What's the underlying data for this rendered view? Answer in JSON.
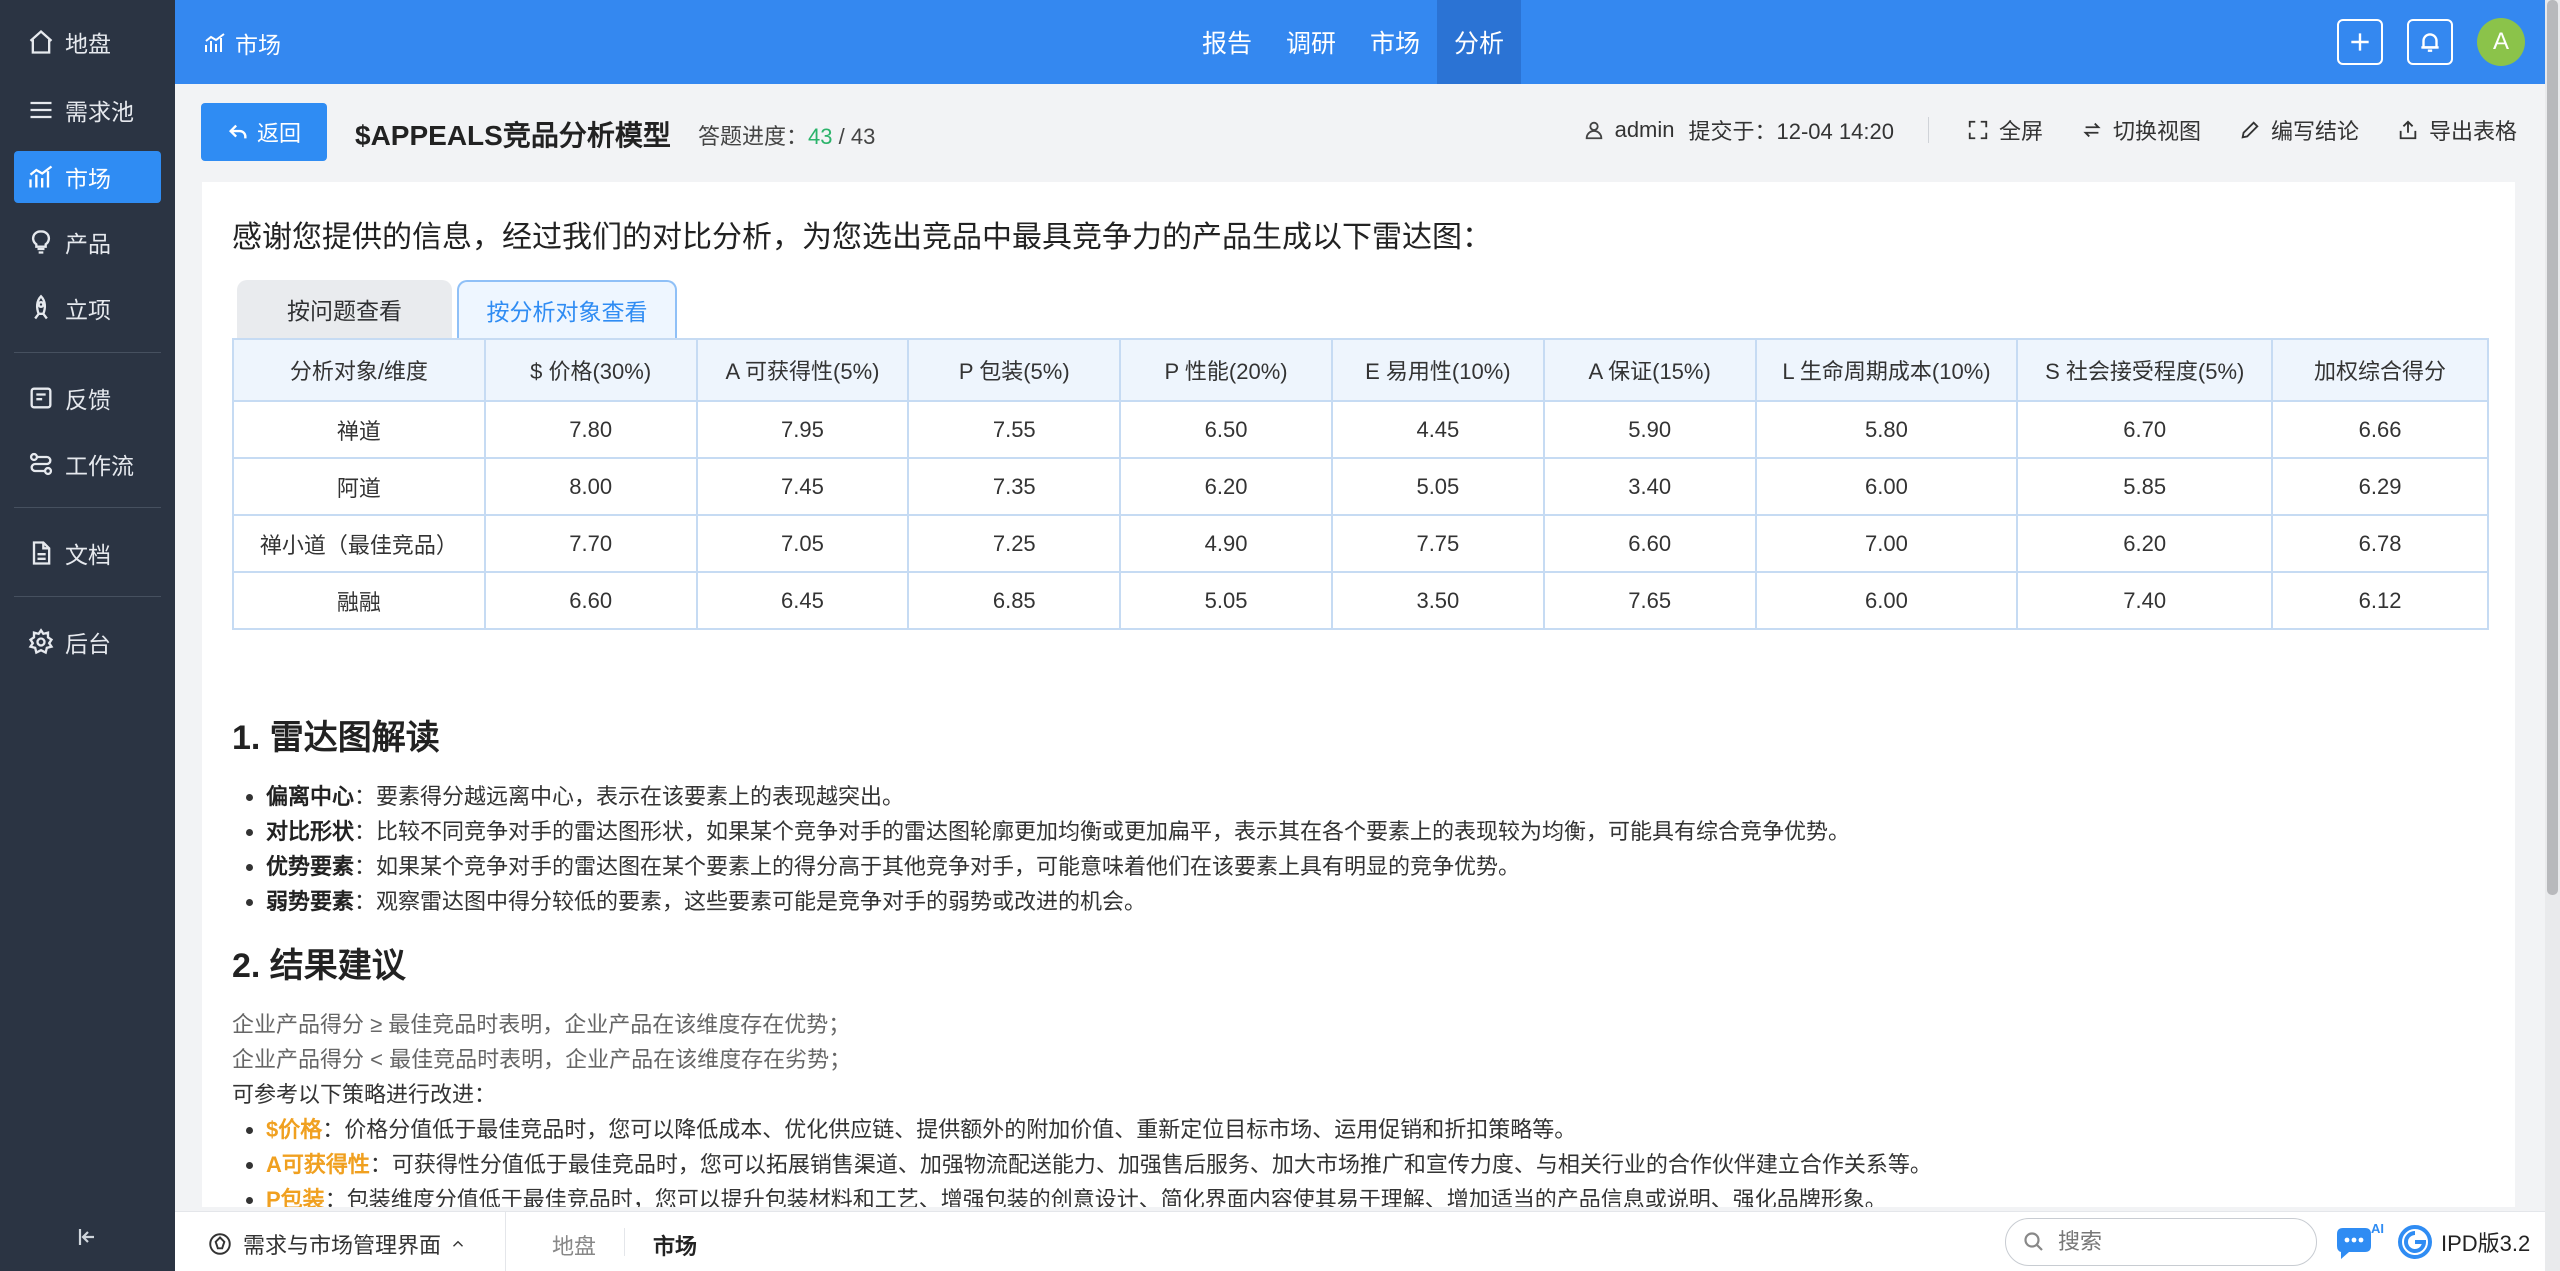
{
  "sidebar": {
    "items": [
      {
        "label": "地盘",
        "icon": "home-icon"
      },
      {
        "label": "需求池",
        "icon": "list-icon"
      },
      {
        "label": "市场",
        "icon": "chart-icon"
      },
      {
        "label": "产品",
        "icon": "bulb-icon"
      },
      {
        "label": "立项",
        "icon": "rocket-icon"
      },
      {
        "label": "反馈",
        "icon": "feedback-icon"
      },
      {
        "label": "工作流",
        "icon": "workflow-icon"
      },
      {
        "label": "文档",
        "icon": "document-icon"
      },
      {
        "label": "后台",
        "icon": "gear-icon"
      }
    ],
    "active_index": 2
  },
  "topbar": {
    "module_title": "市场",
    "tabs": [
      "报告",
      "调研",
      "市场",
      "分析"
    ],
    "active_tab": "分析",
    "avatar_letter": "A",
    "accent_color": "#3488f0"
  },
  "header": {
    "back_label": "返回",
    "title": "$APPEALS竞品分析模型",
    "progress_label": "答题进度：",
    "progress_done": "43",
    "progress_sep": " / ",
    "progress_total": "43",
    "user": "admin",
    "submitted": "提交于：12-04 14:20",
    "actions": {
      "fullscreen": "全屏",
      "switch_view": "切换视图",
      "write_conclusion": "编写结论",
      "export_table": "导出表格"
    }
  },
  "content": {
    "intro": "感谢您提供的信息，经过我们的对比分析，为您选出竞品中最具竞争力的产品生成以下雷达图：",
    "tabs": [
      "按问题查看",
      "按分析对象查看"
    ],
    "active_tab": "按分析对象查看",
    "table": {
      "headers": [
        "分析对象/维度",
        "$ 价格(30%)",
        "A 可获得性(5%)",
        "P 包装(5%)",
        "P 性能(20%)",
        "E 易用性(10%)",
        "A 保证(15%)",
        "L 生命周期成本(10%)",
        "S 社会接受程度(5%)",
        "加权综合得分"
      ],
      "rows": [
        [
          "禅道",
          "7.80",
          "7.95",
          "7.55",
          "6.50",
          "4.45",
          "5.90",
          "5.80",
          "6.70",
          "6.66"
        ],
        [
          "阿道",
          "8.00",
          "7.45",
          "7.35",
          "6.20",
          "5.05",
          "3.40",
          "6.00",
          "5.85",
          "6.29"
        ],
        [
          "禅小道（最佳竞品）",
          "7.70",
          "7.05",
          "7.25",
          "4.90",
          "7.75",
          "6.60",
          "7.00",
          "6.20",
          "6.78"
        ],
        [
          "融融",
          "6.60",
          "6.45",
          "6.85",
          "5.05",
          "3.50",
          "7.65",
          "6.00",
          "7.40",
          "6.12"
        ]
      ]
    },
    "section1": {
      "title": "1. 雷达图解读",
      "items": [
        {
          "term": "偏离中心",
          "text": "：要素得分越远离中心，表示在该要素上的表现越突出。"
        },
        {
          "term": "对比形状",
          "text": "：比较不同竞争对手的雷达图形状，如果某个竞争对手的雷达图轮廓更加均衡或更加扁平，表示其在各个要素上的表现较为均衡，可能具有综合竞争优势。"
        },
        {
          "term": "优势要素",
          "text": "：如果某个竞争对手的雷达图在某个要素上的得分高于其他竞争对手，可能意味着他们在该要素上具有明显的竞争优势。"
        },
        {
          "term": "弱势要素",
          "text": "：观察雷达图中得分较低的要素，这些要素可能是竞争对手的弱势或改进的机会。"
        }
      ]
    },
    "section2": {
      "title": "2. 结果建议",
      "line1": "企业产品得分 ≥ 最佳竞品时表明，企业产品在该维度存在优势；",
      "line2": "企业产品得分 < 最佳竞品时表明，企业产品在该维度存在劣势；",
      "line3": "可参考以下策略进行改进：",
      "items": [
        {
          "term": "$价格",
          "text": "：价格分值低于最佳竞品时，您可以降低成本、优化供应链、提供额外的附加价值、重新定位目标市场、运用促销和折扣策略等。"
        },
        {
          "term": "A可获得性",
          "text": "：可获得性分值低于最佳竞品时，您可以拓展销售渠道、加强物流配送能力、加强售后服务、加大市场推广和宣传力度、与相关行业的合作伙伴建立合作关系等。"
        },
        {
          "term": "P包装",
          "text": "：包装维度分值低于最佳竞品时，您可以提升包装材料和工艺、增强包装的创意设计、简化界面内容使其易于理解、增加适当的产品信息或说明、强化品牌形象。"
        }
      ],
      "term_color": "#f0a020"
    }
  },
  "bottombar": {
    "home_label": "需求与市场管理界面",
    "crumbs": [
      "地盘",
      "市场"
    ],
    "search_placeholder": "搜索",
    "version": "IPD版3.2",
    "ai_badge": "AI"
  }
}
